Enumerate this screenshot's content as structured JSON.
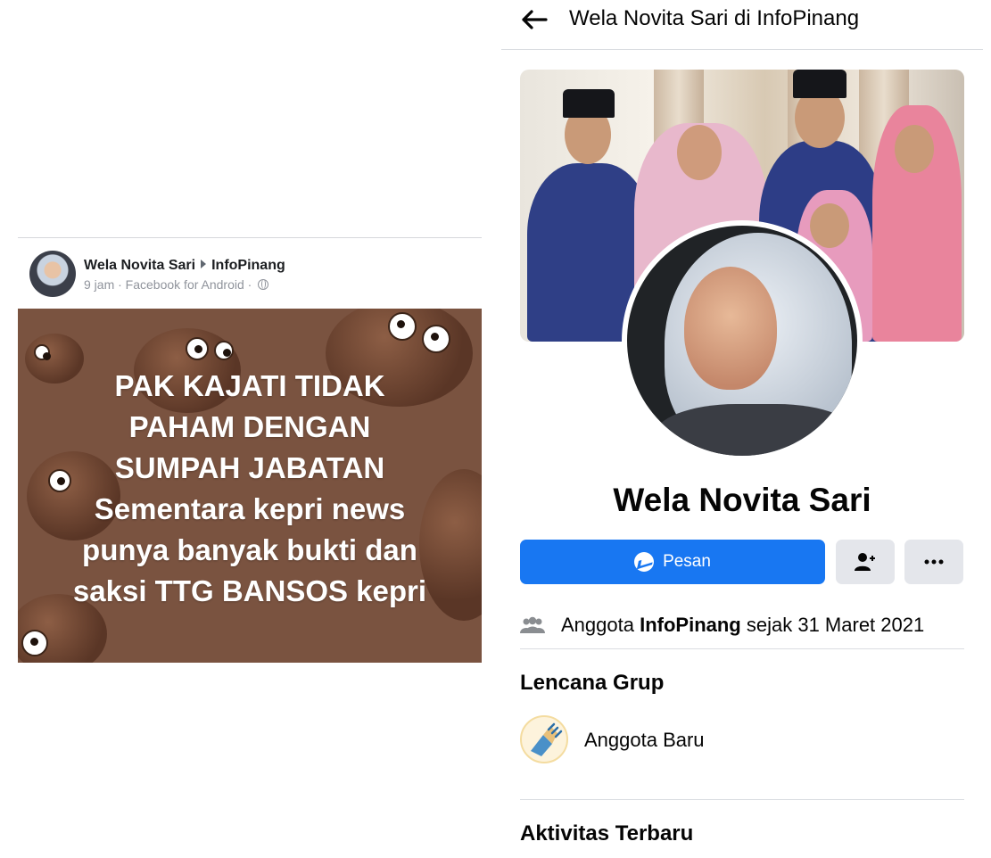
{
  "post": {
    "author": "Wela Novita Sari",
    "group": "InfoPinang",
    "meta": "9 jam · Facebook for Android ·",
    "image_text": [
      "PAK KAJATI TIDAK",
      "PAHAM DENGAN",
      "SUMPAH JABATAN",
      "Sementara kepri news",
      "punya banyak bukti dan",
      "saksi TTG BANSOS kepri"
    ]
  },
  "profile": {
    "header_title": "Wela Novita Sari di InfoPinang",
    "name": "Wela Novita Sari",
    "message_button": "Pesan",
    "member_prefix": "Anggota",
    "member_group": "InfoPinang",
    "member_suffix": "sejak 31 Maret 2021",
    "badges_title": "Lencana Grup",
    "badge_label": "Anggota Baru",
    "activity_title": "Aktivitas Terbaru"
  },
  "icons": {
    "back": "arrow-left-icon",
    "globe": "globe-icon",
    "messenger": "messenger-icon",
    "add_friend": "add-friend-icon",
    "more": "more-dots-icon",
    "members": "group-members-icon",
    "badge": "new-member-badge-icon"
  },
  "colors": {
    "primary": "#1877f2",
    "secondary_button": "#e4e6eb",
    "meta_text": "#90949c",
    "post_background": "#7a5340"
  }
}
